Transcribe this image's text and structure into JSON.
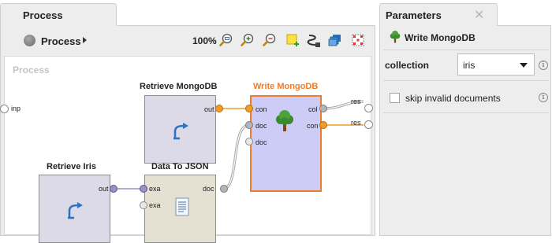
{
  "process_tab": {
    "title": "Process"
  },
  "toolbar": {
    "breadcrumb": "Process",
    "zoom": "100%",
    "icons": [
      "zoom-fit-icon",
      "zoom-in-icon",
      "zoom-out-icon",
      "add-note-icon",
      "auto-wire-icon",
      "layers-icon",
      "arrange-icon"
    ]
  },
  "canvas": {
    "title": "Process",
    "process_ports": {
      "input": "inp",
      "results": [
        "res",
        "res"
      ]
    },
    "operators": [
      {
        "id": "retrieve-mongodb",
        "name": "Retrieve MongoDB",
        "icon": "retrieve-arrow-icon",
        "outputs": [
          "out"
        ]
      },
      {
        "id": "write-mongodb",
        "name": "Write MongoDB",
        "icon": "tree-icon",
        "inputs": [
          "con",
          "doc",
          "doc"
        ],
        "outputs": [
          "col",
          "con"
        ],
        "selected": true
      },
      {
        "id": "retrieve-iris",
        "name": "Retrieve Iris",
        "icon": "retrieve-arrow-icon",
        "outputs": [
          "out"
        ]
      },
      {
        "id": "data-to-json",
        "name": "Data To JSON",
        "icon": "document-icon",
        "inputs": [
          "exa",
          "exa"
        ],
        "outputs": [
          "doc"
        ]
      }
    ]
  },
  "parameters": {
    "tab_title": "Parameters",
    "close_glyph": "✕",
    "operator_name": "Write MongoDB",
    "collection": {
      "label": "collection",
      "value": "iris"
    },
    "skip_invalid": {
      "label": "skip invalid documents",
      "checked": false
    },
    "info_glyph": "i"
  },
  "colors": {
    "selected_border": "#f07b2a",
    "connection_orange": "#f39c23",
    "port_purple": "#9a90c2",
    "port_gray": "#b5b5b5",
    "selected_fill": "#ccccf7"
  }
}
